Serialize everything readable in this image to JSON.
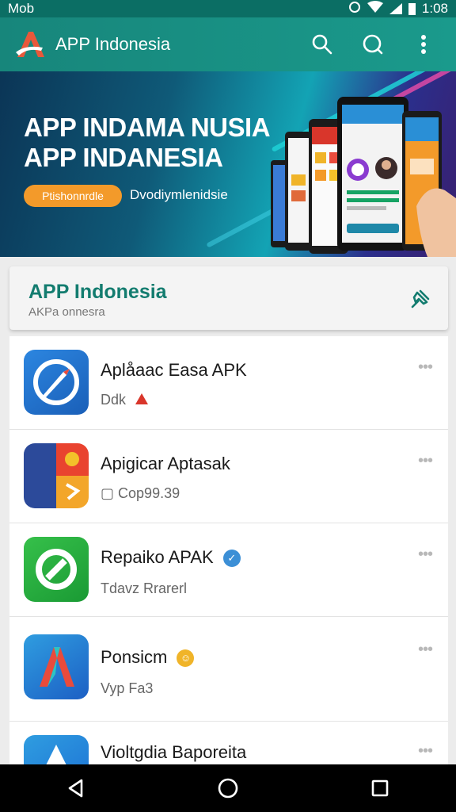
{
  "status_bar": {
    "carrier": "Mob",
    "time": "1:08"
  },
  "app_bar": {
    "title": "APP Indonesia",
    "icons": [
      "search-icon",
      "chat-icon",
      "more-vert-icon"
    ]
  },
  "banner": {
    "headline_line1": "APP INDAMA NUSIA",
    "headline_line2": "APP INDANESIA",
    "cta_label": "Ptishonnrdle",
    "subtitle": "Dvodiymlenidsie"
  },
  "header_card": {
    "title": "APP Indonesia",
    "subtitle": "AKPa onnesra"
  },
  "apps": [
    {
      "name": "Aplåaac Easa APK",
      "meta": "Ddk",
      "icon": "rocket-compass-icon"
    },
    {
      "name": "Apigicar Aptasak",
      "meta": "Cop99.39",
      "icon": "grid-apps-icon"
    },
    {
      "name": "Repaiko APAK",
      "meta": "Tdavz Rrarerl",
      "icon": "green-circle-app-icon"
    },
    {
      "name": "Ponsicm",
      "meta": "Vyp Fa3",
      "icon": "letter-a-app-icon"
    },
    {
      "name": "Violtgdia Baporeita",
      "meta": "",
      "icon": "triangle-app-icon"
    }
  ],
  "colors": {
    "primary": "#17867b",
    "accent": "#f39a2a",
    "title_green": "#137c6f"
  }
}
